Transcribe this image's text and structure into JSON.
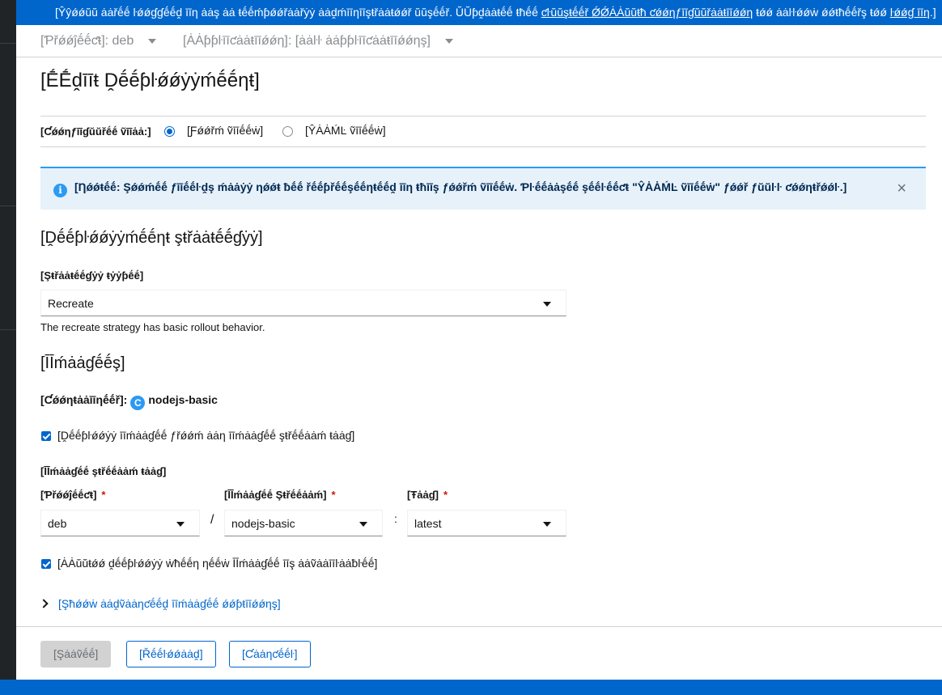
{
  "banner": {
    "text_before": "[Ŷŷǿǿŭŭ ȧȧřḗḗ ŀǿǿɠɠḗḗḓ īīƞ ȧȧş ȧȧ ŧḗḗḿƥǿǿřȧȧřẏẏ ȧȧḓḿīīƞīīşŧřȧȧŧǿǿř ŭŭşḗḗř. ŬŬƥḓȧȧŧḗḗ ŧħḗḗ ",
    "link1": "ƈŀŭŭşŧḗḗř ǾǾȦȦŭŭŧħ ƈǿǿƞƒīīɠŭŭřȧȧŧīīǿǿƞ",
    "text_middle": " ŧǿǿ ȧȧŀŀǿǿẇ ǿǿŧħḗḗřş ŧǿǿ ",
    "link2": "ŀǿǿɠ īīƞ",
    "text_after": ".]"
  },
  "context": {
    "project": "[Ƥřǿǿĵḗḗƈŧ]: deb",
    "application": "[ȦȦƥƥŀīīƈȧȧŧīīǿǿƞ]: [ȧȧŀŀ ȧȧƥƥŀīīƈȧȧŧīīǿǿƞş]"
  },
  "page": {
    "title": "[ḖḖḓīīŧ Ḓḗḗƥŀǿǿẏẏḿḗḗƞŧ]"
  },
  "configure": {
    "label": "[Ƈǿǿƞƒīīɠŭŭřḗḗ ṽīīȧȧ:]",
    "form_view": "[Ƒǿǿřḿ ṽīīḗḗẇ]",
    "yaml_view": "[ŶȦȦḾĿ ṽīīḗḗẇ]",
    "selected": "form"
  },
  "alert": {
    "text": "[Ƞǿǿŧḗḗ: Şǿǿḿḗḗ ƒīīḗḗŀḓş ḿȧȧẏẏ ƞǿǿŧ ƀḗḗ řḗḗƥřḗḗşḗḗƞŧḗḗḓ īīƞ ŧħīīş ƒǿǿřḿ ṽīīḗḗẇ. Ƥŀḗḗȧȧşḗḗ şḗḗŀḗḗƈŧ \"ŶȦȦḾĿ ṽīīḗḗẇ\" ƒǿǿř ƒŭŭŀŀ ƈǿǿƞŧřǿǿŀ.]",
    "close": "×",
    "icon": "info-icon"
  },
  "strategy": {
    "heading": "[Ḓḗḗƥŀǿǿẏẏḿḗḗƞŧ şŧřȧȧŧḗḗɠẏẏ]",
    "type_label": "[Şŧřȧȧŧḗḗɠẏẏ ŧẏẏƥḗḗ]",
    "type_value": "Recreate",
    "help": "The recreate strategy has basic rollout behavior."
  },
  "images": {
    "heading": "[ĪĪḿȧȧɠḗḗş]",
    "container_label": "[Ƈǿǿƞŧȧȧīīƞḗḗř]:",
    "container_badge": "C",
    "container_name": "nodejs-basic",
    "deploy_from_stream": "[Ḓḗḗƥŀǿǿẏẏ īīḿȧȧɠḗḗ ƒřǿǿḿ ȧȧƞ īīḿȧȧɠḗḗ şŧřḗḗȧȧḿ ŧȧȧɠ]",
    "stream_tag_label": "[ĪĪḿȧȧɠḗḗ şŧřḗḗȧȧḿ ŧȧȧɠ]",
    "project_label": "[Ƥřǿǿĵḗḗƈŧ]",
    "project_value": "deb",
    "stream_label": "[ĪĪḿȧȧɠḗḗ Şŧřḗḗȧȧḿ]",
    "stream_value": "nodejs-basic",
    "tag_label": "[Ŧȧȧɠ]",
    "tag_value": "latest",
    "required": "*",
    "sep_slash": "/",
    "sep_colon": ":",
    "auto_deploy": "[ȦȦŭŭŧǿǿ ḓḗḗƥŀǿǿẏẏ ẇħḗḗƞ ƞḗḗẇ ĪĪḿȧȧɠḗḗ īīş ȧȧṽȧȧīīŀȧȧƀŀḗḗ]",
    "advanced_link": "[Şħǿǿẇ ȧȧḓṽȧȧƞƈḗḗḓ īīḿȧȧɠḗḗ ǿǿƥŧīīǿǿƞş]"
  },
  "footer": {
    "save": "[Şȧȧṽḗḗ]",
    "reload": "[Řḗḗŀǿǿȧȧḓ]",
    "cancel": "[Ƈȧȧƞƈḗḗŀ]"
  },
  "colors": {
    "primary": "#0066cc",
    "info": "#2b9af3",
    "alert_bg": "#e7f1fa",
    "required": "#c9190b"
  }
}
